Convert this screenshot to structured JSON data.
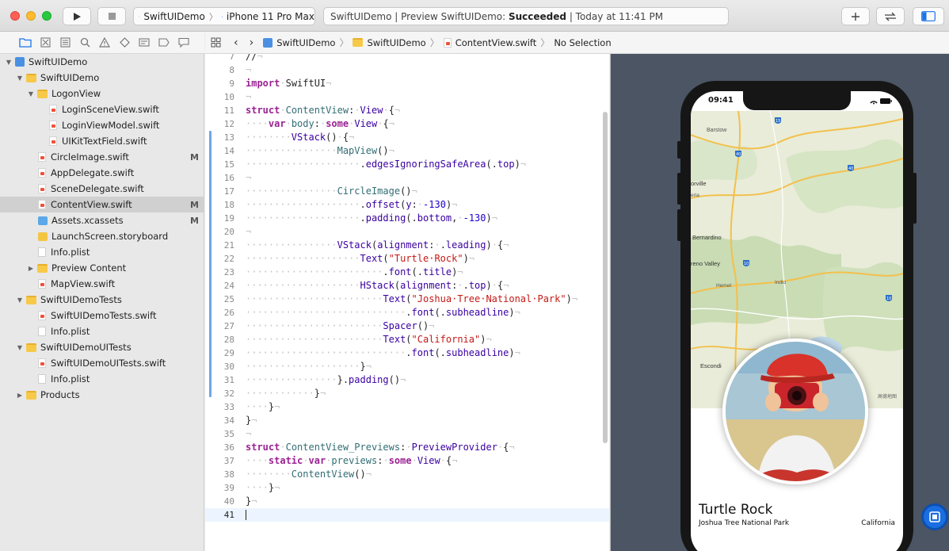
{
  "toolbar": {
    "scheme_project": "SwiftUIDemo",
    "scheme_device": "iPhone 11 Pro Max",
    "activity_prefix": "SwiftUIDemo | Preview SwiftUIDemo: ",
    "activity_status": "Succeeded",
    "activity_suffix": " | Today at 11:41 PM"
  },
  "navigator": {
    "items": [
      {
        "label": "SwiftUIDemo",
        "badge": ""
      },
      {
        "label": "SwiftUIDemo",
        "badge": ""
      },
      {
        "label": "LogonView",
        "badge": ""
      },
      {
        "label": "LoginSceneView.swift",
        "badge": ""
      },
      {
        "label": "LoginViewModel.swift",
        "badge": ""
      },
      {
        "label": "UIKitTextField.swift",
        "badge": ""
      },
      {
        "label": "CircleImage.swift",
        "badge": "M"
      },
      {
        "label": "AppDelegate.swift",
        "badge": ""
      },
      {
        "label": "SceneDelegate.swift",
        "badge": ""
      },
      {
        "label": "ContentView.swift",
        "badge": "M"
      },
      {
        "label": "Assets.xcassets",
        "badge": "M"
      },
      {
        "label": "LaunchScreen.storyboard",
        "badge": ""
      },
      {
        "label": "Info.plist",
        "badge": ""
      },
      {
        "label": "Preview Content",
        "badge": ""
      },
      {
        "label": "MapView.swift",
        "badge": ""
      },
      {
        "label": "SwiftUIDemoTests",
        "badge": ""
      },
      {
        "label": "SwiftUIDemoTests.swift",
        "badge": ""
      },
      {
        "label": "Info.plist",
        "badge": ""
      },
      {
        "label": "SwiftUIDemoUITests",
        "badge": ""
      },
      {
        "label": "SwiftUIDemoUITests.swift",
        "badge": ""
      },
      {
        "label": "Info.plist",
        "badge": ""
      },
      {
        "label": "Products",
        "badge": ""
      }
    ]
  },
  "jumpbar": {
    "project": "SwiftUIDemo",
    "group": "SwiftUIDemo",
    "file": "ContentView.swift",
    "selection": "No Selection"
  },
  "editor": {
    "line_numbers": [
      "7",
      "8",
      "9",
      "10",
      "11",
      "12",
      "13",
      "14",
      "15",
      "16",
      "17",
      "18",
      "19",
      "20",
      "21",
      "22",
      "23",
      "24",
      "25",
      "26",
      "27",
      "28",
      "29",
      "30",
      "31",
      "32",
      "33",
      "34",
      "35",
      "36",
      "37",
      "38",
      "39",
      "40",
      "41"
    ]
  },
  "preview": {
    "status_time": "09:41",
    "title": "Turtle Rock",
    "park": "Joshua Tree National Park",
    "state": "California",
    "map_labels": {
      "barstow": "Barstow",
      "victorville": "orville",
      "hesperia": "eria",
      "san_bernardino": "Bernardino",
      "moreno_valley": "reno Valley",
      "hemet": "Hemet",
      "indio": "Indio",
      "escondido": "Escondi",
      "attribution": "高德地图",
      "route_15": "15",
      "route_40a": "40",
      "route_40b": "40",
      "route_10": "10",
      "route_10b": "10"
    }
  }
}
